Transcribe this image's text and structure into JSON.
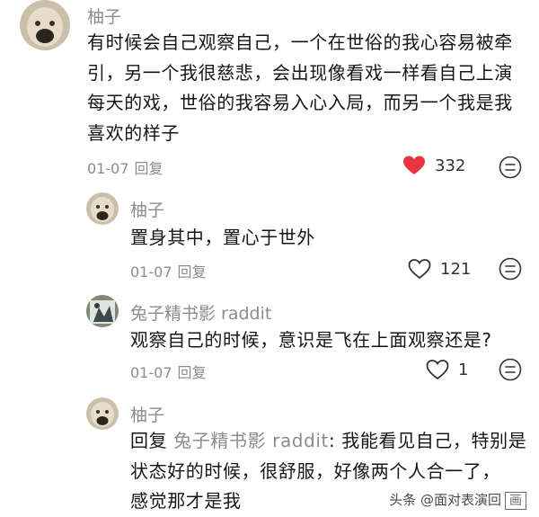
{
  "comments": [
    {
      "username": "柚子",
      "text_lines": [
        "有时候会自己观察自己，一个在世俗的我心容易被牵",
        "引，另一个我很慈悲，会出现像看戏一样看自己上演",
        "每天的戏，世俗的我容易入心入局，而另一个我是我",
        "喜欢的样子"
      ],
      "date": "01-07",
      "reply_label": "回复",
      "likes": "332",
      "liked": true
    },
    {
      "username": "柚子",
      "text_lines": [
        "置身其中，置心于世外"
      ],
      "date": "01-07",
      "reply_label": "回复",
      "likes": "121",
      "liked": false
    },
    {
      "username": "兔子精书影 raddit",
      "text_lines": [
        "观察自己的时候，意识是飞在上面观察还是?"
      ],
      "date": "01-07",
      "reply_label": "回复",
      "likes": "1",
      "liked": false
    },
    {
      "username": "柚子",
      "reply_prefix": "回复",
      "reply_to": "兔子精书影 raddit",
      "first_line_rest": ": 我能看见自己，特别是",
      "text_lines": [
        "状态好的时候，很舒服，好像两个人合一了，",
        "感觉那才是我"
      ]
    }
  ],
  "watermark": {
    "text": "头条 @面对表演回",
    "badge": "画"
  },
  "colors": {
    "liked_heart": "#e8363f",
    "muted_text": "#8c8c8c",
    "body_text": "#161616"
  }
}
